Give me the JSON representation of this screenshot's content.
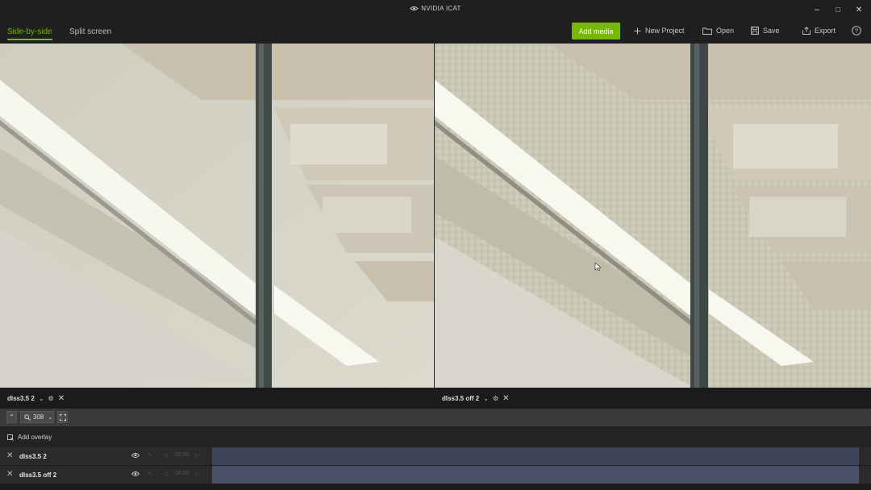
{
  "app": {
    "title": "NVIDIA ICAT"
  },
  "window": {
    "minimize": "–",
    "maximize": "□",
    "close": "✕"
  },
  "view_tabs": [
    {
      "label": "Side-by-side",
      "active": true
    },
    {
      "label": "Split screen",
      "active": false
    }
  ],
  "toolbar": {
    "add_media": "Add media",
    "new_project": "New Project",
    "open": "Open",
    "save": "Save",
    "export": "Export",
    "help_icon": "help-circle-icon"
  },
  "panes": [
    {
      "name": "dlss3.5 2"
    },
    {
      "name": "dlss3.5 off 2"
    }
  ],
  "controls": {
    "zoom_value": "308",
    "zoom_icon": "magnifier-icon",
    "fullscreen_icon": "expand-icon"
  },
  "overlay": {
    "label": "Add overlay"
  },
  "tracks": [
    {
      "name": "dlss3.5 2",
      "time": "00.00",
      "color": "#3d4658"
    },
    {
      "name": "dlss3.5 off 2",
      "time": "00.00",
      "color": "#4a5068"
    }
  ],
  "colors": {
    "accent": "#76b900",
    "background": "#1c1c1c"
  }
}
